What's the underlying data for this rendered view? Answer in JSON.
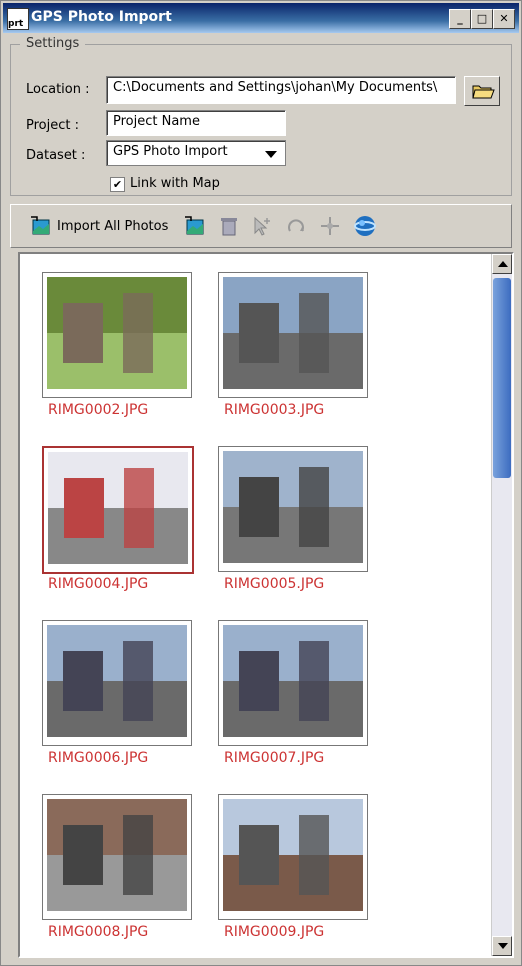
{
  "window": {
    "title": "GPS Photo Import",
    "app_icon_text": "prt"
  },
  "settings": {
    "legend": "Settings",
    "location_label": "Location :",
    "location_value": "C:\\Documents and Settings\\johan\\My Documents\\",
    "project_label": "Project :",
    "project_value": "Project Name",
    "dataset_label": "Dataset :",
    "dataset_value": "GPS Photo Import",
    "link_label": "Link with Map",
    "link_checked": "✔"
  },
  "toolbar": {
    "import_all_label": "Import All Photos",
    "icons": [
      "import-all-icon",
      "import-photo-icon",
      "delete-icon",
      "select-icon",
      "rotate-icon",
      "move-icon",
      "globe-icon"
    ]
  },
  "photos": [
    {
      "name": "RIMG0002.JPG",
      "selected": false
    },
    {
      "name": "RIMG0003.JPG",
      "selected": false
    },
    {
      "name": "RIMG0004.JPG",
      "selected": true
    },
    {
      "name": "RIMG0005.JPG",
      "selected": false
    },
    {
      "name": "RIMG0006.JPG",
      "selected": false
    },
    {
      "name": "RIMG0007.JPG",
      "selected": false
    },
    {
      "name": "RIMG0008.JPG",
      "selected": false
    },
    {
      "name": "RIMG0009.JPG",
      "selected": false
    }
  ]
}
